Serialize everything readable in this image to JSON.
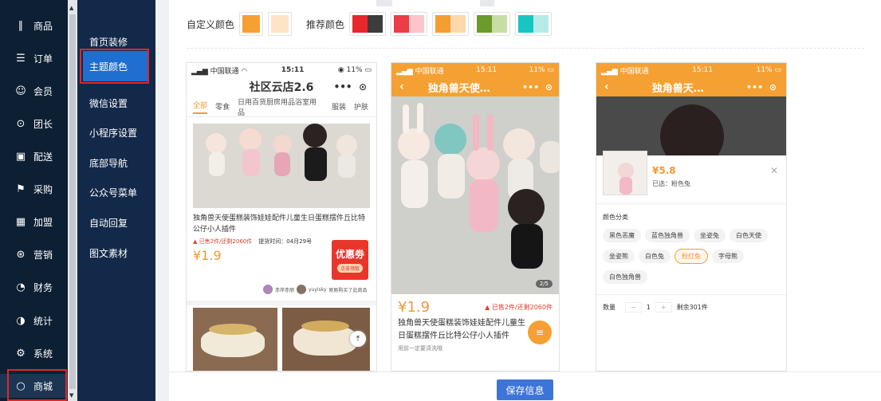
{
  "sidebar": {
    "items": [
      {
        "label": "商品",
        "icon": "barcode-icon",
        "glyph": "∥"
      },
      {
        "label": "订单",
        "icon": "cart-icon",
        "glyph": "☰"
      },
      {
        "label": "会员",
        "icon": "user-icon",
        "glyph": "☺"
      },
      {
        "label": "团长",
        "icon": "medal-icon",
        "glyph": "⊙"
      },
      {
        "label": "配送",
        "icon": "truck-icon",
        "glyph": "▣"
      },
      {
        "label": "采购",
        "icon": "flag-icon",
        "glyph": "⚑"
      },
      {
        "label": "加盟",
        "icon": "store-icon",
        "glyph": "▦"
      },
      {
        "label": "营销",
        "icon": "coupon-icon",
        "glyph": "⊛"
      },
      {
        "label": "财务",
        "icon": "wallet-icon",
        "glyph": "◔"
      },
      {
        "label": "统计",
        "icon": "pie-chart-icon",
        "glyph": "◑"
      },
      {
        "label": "系统",
        "icon": "gear-icon",
        "glyph": "⚙"
      },
      {
        "label": "商城",
        "icon": "mall-icon",
        "glyph": "○"
      }
    ]
  },
  "subnav": {
    "items": [
      "首页装修",
      "主题颜色",
      "微信设置",
      "小程序设置",
      "底部导航",
      "公众号菜单",
      "自动回复",
      "图文素材"
    ],
    "active_index": 1
  },
  "colors": {
    "custom_label": "自定义颜色",
    "recommend_label": "推荐颜色",
    "custom": [
      "#f5a033",
      "#fde4c6"
    ],
    "recommended": [
      [
        "#e8262c",
        "#3c3c3c"
      ],
      [
        "#ec3c47",
        "#fbc5c9"
      ],
      [
        "#f49d33",
        "#fdd8aa"
      ],
      [
        "#6c9a2b",
        "#c6dea4"
      ],
      [
        "#19c5c0",
        "#b6ebe9"
      ]
    ]
  },
  "phone1": {
    "carrier": "中国联通",
    "time": "15:11",
    "battery": "11%",
    "title": "社区云店2.6",
    "tabs": [
      "全部",
      "零食",
      "日用百货厨房用品浴室用品",
      "服装",
      "护肤"
    ],
    "product_title": "独角兽天使蛋糕装饰娃娃配件儿童生日蛋糕摆件丘比特公仔小人插件",
    "sold": "已售2件/还剩2060件",
    "pickup": "提货时间：04月29号",
    "price": "¥1.9",
    "badge": "优惠劵",
    "badge_sub": "点击领取",
    "user1": "赤岸赤丽",
    "user2": "yuyisky",
    "user_note": "刚刚购买了此商品"
  },
  "phone2": {
    "carrier": "中国联通",
    "time": "15:11",
    "battery": "11%",
    "title": "独角兽天使…",
    "page": "2/5",
    "price": "¥1.9",
    "sold": "已售2件/还剩2060件",
    "product_title": "独角兽天使蛋糕装饰娃娃配件儿童生日蛋糕摆件丘比特公仔小人插件",
    "note": "用前一定要清洗哦"
  },
  "phone3": {
    "carrier": "中国联通",
    "time": "15:11",
    "battery": "11%",
    "title": "独角兽天…",
    "price": "¥5.8",
    "selected": "已选：粉色兔",
    "category_label": "颜色分类",
    "chips": [
      "黑色恶魔",
      "蓝色独角兽",
      "坐姿兔",
      "白色天使",
      "坐姿熊",
      "白色兔",
      "粉红兔",
      "字母熊",
      "白色独角兽"
    ],
    "active_chip": "粉红兔",
    "qty_label": "数量",
    "qty": "1",
    "stock": "剩余301件"
  },
  "actions": {
    "save_label": "保存信息"
  }
}
